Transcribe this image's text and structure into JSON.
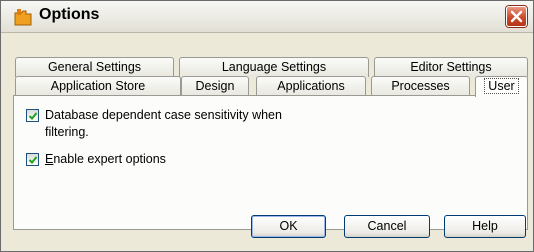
{
  "window": {
    "title": "Options",
    "icon": "folder-icon",
    "close_icon": "close-x-icon",
    "close_color": "#cc4a2b"
  },
  "tabs": {
    "row_top": [
      "General Settings",
      "Language Settings",
      "Editor Settings"
    ],
    "row_bottom": [
      "Application Store",
      "Design",
      "Applications",
      "Processes",
      "User"
    ],
    "active": "User"
  },
  "options": [
    {
      "label_line1": "Database dependent case sensitivity when",
      "label_line2": "filtering.",
      "checked": true
    },
    {
      "label_prefix": "",
      "label_underlined": "E",
      "label_rest": "nable expert options",
      "checked": true
    }
  ],
  "buttons": {
    "ok": "OK",
    "cancel": "Cancel",
    "help": "Help"
  }
}
